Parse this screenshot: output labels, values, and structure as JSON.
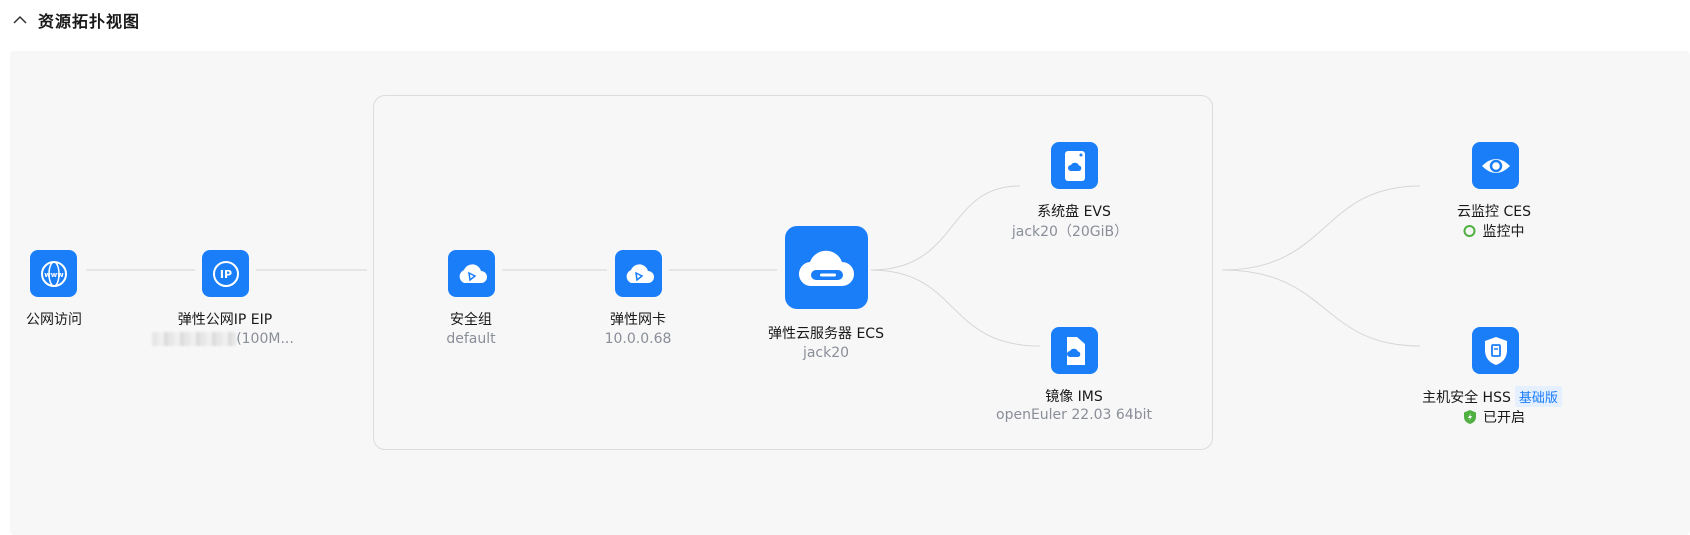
{
  "section": {
    "title": "资源拓扑视图"
  },
  "nodes": {
    "internet": {
      "label": "公网访问"
    },
    "eip": {
      "label": "弹性公网IP EIP",
      "detail": "(100M..."
    },
    "secgroup": {
      "label": "安全组",
      "detail": "default"
    },
    "nic": {
      "label": "弹性网卡",
      "detail": "10.0.0.68"
    },
    "ecs": {
      "label": "弹性云服务器 ECS",
      "detail": "jack20"
    },
    "evs": {
      "label": "系统盘 EVS",
      "detail": "jack20（20GiB）"
    },
    "ims": {
      "label": "镜像 IMS",
      "detail": "openEuler 22.03 64bit"
    },
    "ces": {
      "label": "云监控 CES",
      "status": "监控中"
    },
    "hss": {
      "label": "主机安全 HSS",
      "badge": "基础版",
      "status": "已开启"
    }
  },
  "colors": {
    "accent": "#1b7ef9",
    "success": "#50b041",
    "line": "#d6d6d6"
  },
  "icons": {
    "internet": "www-globe-icon",
    "eip": "ip-address-icon",
    "secgroup": "cloud-network-icon",
    "nic": "cloud-network-icon",
    "ecs": "cloud-server-icon",
    "evs": "disk-icon",
    "ims": "image-file-icon",
    "ces": "eye-icon",
    "hss": "shield-icon"
  }
}
